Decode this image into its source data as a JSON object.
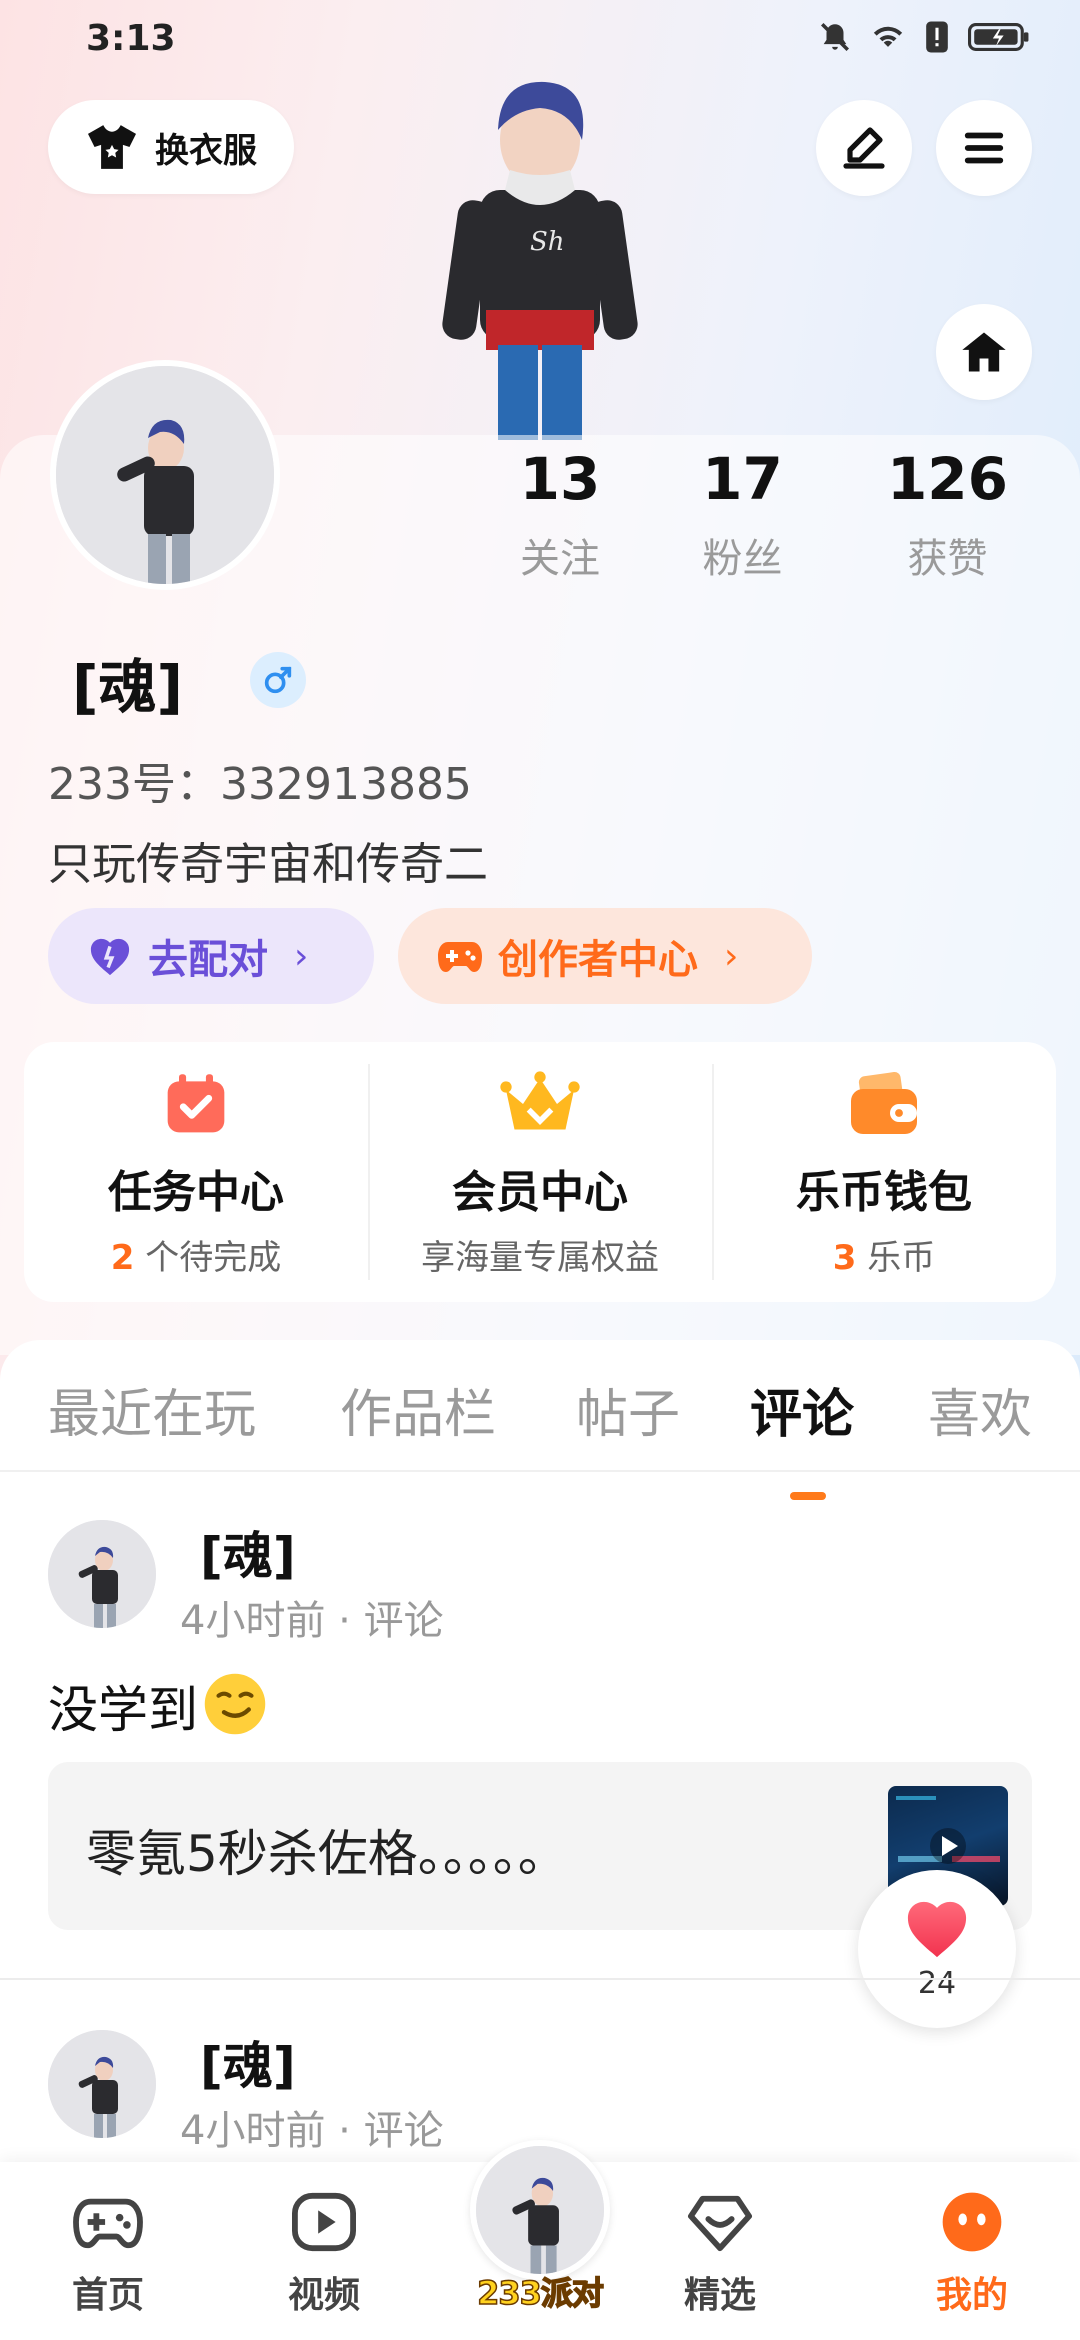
{
  "status_bar": {
    "time": "3:13"
  },
  "top_actions": {
    "outfit_label": "换衣服"
  },
  "stats": [
    {
      "value": "13",
      "label": "关注"
    },
    {
      "value": "17",
      "label": "粉丝"
    },
    {
      "value": "126",
      "label": "获赞"
    }
  ],
  "profile": {
    "name": "[魂]",
    "uid": "233号：332913885",
    "bio": "只玩传奇宇宙和传奇二"
  },
  "pills": {
    "match_label": "去配对",
    "creator_label": "创作者中心"
  },
  "quick_entries": [
    {
      "title": "任务中心",
      "count": "2",
      "sub": "个待完成"
    },
    {
      "title": "会员中心",
      "sub": "享海量专属权益"
    },
    {
      "title": "乐币钱包",
      "count": "3",
      "sub": "乐币"
    }
  ],
  "tabs": [
    "最近在玩",
    "作品栏",
    "帖子",
    "评论",
    "喜欢"
  ],
  "active_tab": "评论",
  "posts": [
    {
      "name": "[魂]",
      "meta": "4小时前 · 评论",
      "text": "没学到",
      "quote": "零氪5秒杀佐格。。。。。"
    },
    {
      "name": "[魂]",
      "meta": "4小时前 · 评论"
    }
  ],
  "like_count": "24",
  "bottom_nav": [
    {
      "label": "首页"
    },
    {
      "label": "视频"
    },
    {
      "label": "233派对"
    },
    {
      "label": "精选"
    },
    {
      "label": "我的"
    }
  ],
  "colors": {
    "accent": "#ff6a1a",
    "match_pill": "#ece6fb",
    "creator_pill": "#fde6dc"
  }
}
